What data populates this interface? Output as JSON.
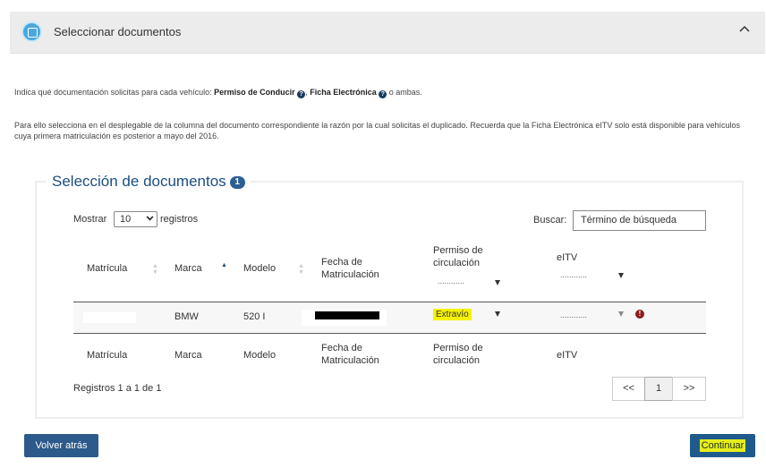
{
  "accordion": {
    "title": "Seleccionar documentos"
  },
  "intro": {
    "line1_prefix": "Indica qué documentación solicitas para cada vehículo: ",
    "doc1": "Permiso de Conducir",
    "sep": ", ",
    "doc2": "Ficha Electrónica",
    "suffix": " o ambas.",
    "help_glyph": "?",
    "paragraph2": "Para ello selecciona en el desplegable de la columna del documento correspondiente la razón por la cual solicitas el duplicado. Recuerda que la Ficha Electrónica eITV solo está disponible para vehículos cuya primera matriculación es posterior a mayo del 2016."
  },
  "panel": {
    "title": "Selección de documentos",
    "badge": "1"
  },
  "table_controls": {
    "show_label": "Mostrar",
    "page_size": "10",
    "records_label": "registros",
    "search_label": "Buscar:",
    "search_placeholder": "Término de búsqueda"
  },
  "columns": {
    "matricula": "Matrícula",
    "marca": "Marca",
    "modelo": "Modelo",
    "fecha_line1": "Fecha de",
    "fecha_line2": "Matriculación",
    "permiso_line1": "Permiso de",
    "permiso_line2": "circulación",
    "eitv": "eITV",
    "filter_placeholder": "............"
  },
  "rows": [
    {
      "matricula": "",
      "marca": "BMW",
      "modelo": "520 I",
      "fecha": "",
      "permiso": "Extravío",
      "eitv": "............"
    }
  ],
  "footer": {
    "info": "Registros 1 a 1 de 1",
    "prev": "<<",
    "page": "1",
    "next": ">>"
  },
  "buttons": {
    "back": "Volver atrás",
    "continue": "Continuar"
  },
  "colors": {
    "accent": "#1c4e80",
    "highlight": "#f5f200",
    "button": "#2c5a8a"
  }
}
